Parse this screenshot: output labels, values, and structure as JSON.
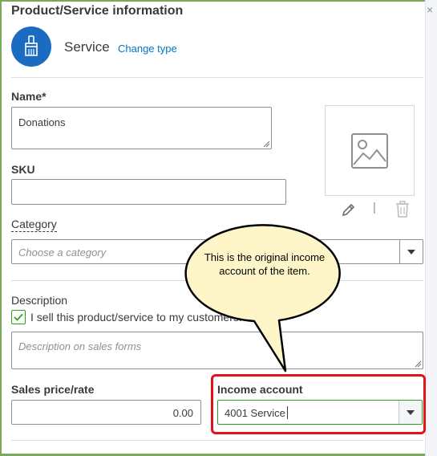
{
  "header": {
    "title": "Product/Service information",
    "close_label": "×"
  },
  "type_section": {
    "type_label": "Service",
    "change_type_label": "Change type",
    "icon": "paintbrush-icon"
  },
  "form": {
    "name_label": "Name*",
    "name_value": "Donations",
    "sku_label": "SKU",
    "sku_value": "",
    "category_label": "Category",
    "category_placeholder": "Choose a category",
    "description_label": "Description",
    "sell_checkbox_label": "I sell this product/service to my customers.",
    "sell_checked": true,
    "description_placeholder": "Description on sales forms",
    "sales_price_label": "Sales price/rate",
    "sales_price_value": "0.00",
    "income_account_label": "Income account",
    "income_account_value": "4001 Service"
  },
  "image_actions": {
    "edit_icon": "pencil-icon",
    "separator": "|",
    "delete_icon": "trash-icon"
  },
  "annotation": {
    "callout_text": "This is the original income account of the item.",
    "highlight_color": "#e1141c",
    "callout_fill": "#fef6c8"
  },
  "colors": {
    "brand_blue": "#1b6cc1",
    "link_blue": "#0077c5",
    "check_green": "#2ca01c",
    "frame_green": "#79a95a"
  }
}
